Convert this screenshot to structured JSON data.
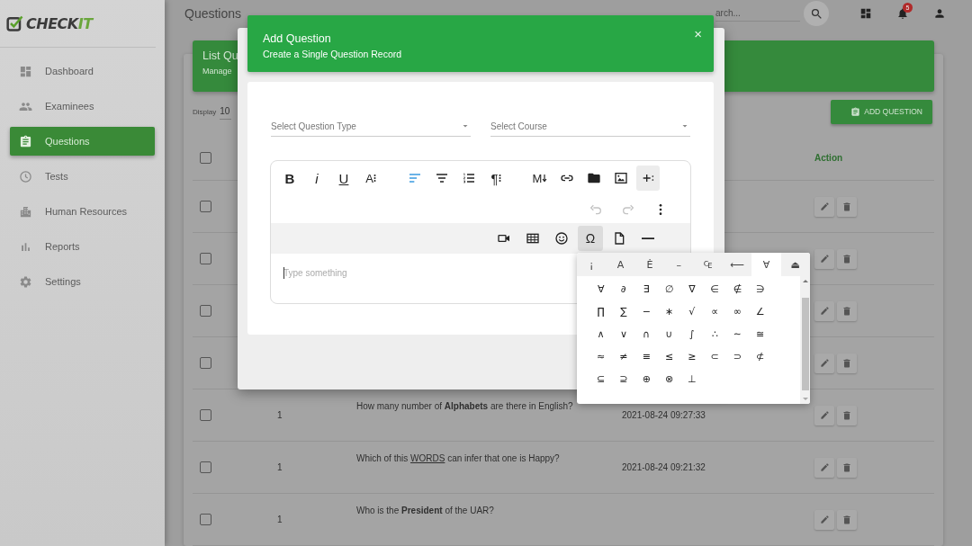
{
  "sidebar": {
    "logo": {
      "main": "CHECK",
      "accent": "IT"
    },
    "items": [
      {
        "label": "Dashboard",
        "kind": "dashboard",
        "selected": false
      },
      {
        "label": "Examinees",
        "kind": "people",
        "selected": false
      },
      {
        "label": "Questions",
        "kind": "clipboard",
        "selected": true
      },
      {
        "label": "Tests",
        "kind": "clock",
        "selected": false
      },
      {
        "label": "Human Resources",
        "kind": "buildings",
        "selected": false
      },
      {
        "label": "Reports",
        "kind": "bars",
        "selected": false
      },
      {
        "label": "Settings",
        "kind": "gear",
        "selected": false
      }
    ]
  },
  "topbar": {
    "title": "Questions",
    "search": {
      "placeholder": "arch..."
    },
    "notification_count": "5"
  },
  "card": {
    "title": "List Qu",
    "subtitle": "Manage",
    "display_label": "Display",
    "display_value": "10",
    "add_button": "ADD QUESTION",
    "action_header": "Action",
    "header_checked": false,
    "rows": [
      {
        "checked": false
      },
      {
        "checked": false
      },
      {
        "checked": false
      },
      {
        "checked": false
      },
      {
        "checked": false,
        "number": "1",
        "question": "How many number of **Alphabets** are there in English?",
        "date": "2021-08-24 09:27:33"
      },
      {
        "checked": false,
        "number": "1",
        "question_parts": [
          {
            "text": "Which of this ",
            "underline": false
          },
          {
            "text": "WORDS",
            "underline": true
          },
          {
            "text": " can infer that one is Happy?",
            "underline": false
          }
        ],
        "date": "2021-08-24 09:21:32"
      },
      {
        "checked": false,
        "number": "1",
        "question": "Who is the **President** of the UAR?"
      }
    ]
  },
  "modal": {
    "title": "Add Question",
    "subtitle": "Create a Single Question Record",
    "close": "×",
    "selects": [
      {
        "placeholder": "Select Question Type"
      },
      {
        "placeholder": "Select Course"
      }
    ],
    "editor": {
      "toolbar": [
        {
          "kind": "bold",
          "label": "B",
          "active": false
        },
        {
          "kind": "italic",
          "label": "i",
          "active": false
        },
        {
          "kind": "underline",
          "label": "U",
          "active": false
        },
        {
          "kind": "font-size",
          "label": "A",
          "active": false
        },
        {
          "kind": "gap"
        },
        {
          "kind": "align-left",
          "active": true
        },
        {
          "kind": "align-center",
          "active": false
        },
        {
          "kind": "list",
          "active": false
        },
        {
          "kind": "paragraph",
          "label": "¶",
          "active": false
        },
        {
          "kind": "gap"
        },
        {
          "kind": "markdown",
          "label": "M",
          "active": false
        },
        {
          "kind": "link",
          "active": false
        },
        {
          "kind": "folder",
          "active": false
        },
        {
          "kind": "image",
          "active": false
        },
        {
          "kind": "plus",
          "active": true
        }
      ],
      "toolbar_2": [
        {
          "kind": "undo",
          "disabled": true
        },
        {
          "kind": "redo",
          "disabled": true
        }
      ],
      "more_menu": {
        "kind": "more"
      },
      "toolbar_3": [
        {
          "kind": "video",
          "active": false
        },
        {
          "kind": "table",
          "active": false
        },
        {
          "kind": "emoji",
          "active": false
        },
        {
          "kind": "omega",
          "label": "Ω",
          "active": true
        },
        {
          "kind": "file",
          "active": false
        },
        {
          "kind": "rule",
          "active": false
        }
      ],
      "placeholder": "Type something"
    }
  },
  "symbol_panel": {
    "tabs": [
      {
        "label": "¡",
        "selected": false
      },
      {
        "label": "A",
        "selected": false
      },
      {
        "label": "Ė",
        "selected": false
      },
      {
        "label": "–",
        "selected": false
      },
      {
        "label": "₠",
        "selected": false
      },
      {
        "label": "⟵",
        "selected": false
      },
      {
        "label": "∀",
        "selected": true
      },
      {
        "label": "⏏",
        "selected": false
      }
    ],
    "symbols": [
      "∀",
      "∂",
      "∃",
      "∅",
      "∇",
      "∈",
      "∉",
      "∋",
      "∏",
      "∑",
      "−",
      "∗",
      "√",
      "∝",
      "∞",
      "∠",
      "∧",
      "∨",
      "∩",
      "∪",
      "∫",
      "∴",
      "∼",
      "≅",
      "≈",
      "≠",
      "≡",
      "≤",
      "≥",
      "⊂",
      "⊃",
      "⊄",
      "⊆",
      "⊇",
      "⊕",
      "⊗",
      "⊥"
    ]
  }
}
